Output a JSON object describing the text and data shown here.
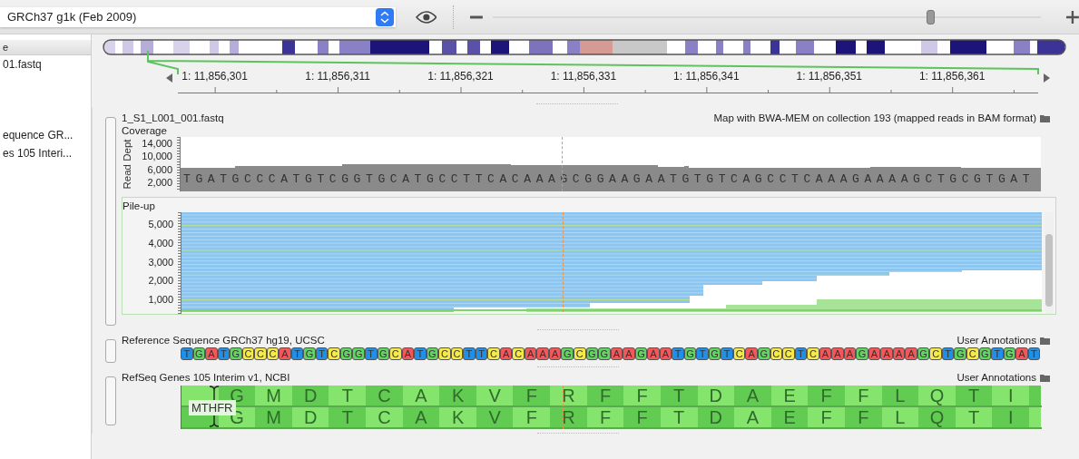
{
  "genome_selector": {
    "value": "GRCh37 g1k (Feb 2009)"
  },
  "zoom_slider": {
    "level": 0.8
  },
  "sidebar": {
    "header": "e",
    "items": [
      "01.fastq",
      "equence GR...",
      "es 105 Interi..."
    ]
  },
  "ruler": {
    "labels": [
      "1: 11,856,301",
      "1: 11,856,311",
      "1: 11,856,321",
      "1: 11,856,331",
      "1: 11,856,341",
      "1: 11,856,351",
      "1: 11,856,361"
    ]
  },
  "alignment_track": {
    "title": "1_S1_L001_001.fastq",
    "source": "Map with BWA-MEM on collection 193 (mapped reads in BAM format)",
    "coverage": {
      "label": "Coverage",
      "axis_title": "Read Dept",
      "ticks": [
        "14,000",
        "10,000",
        "6,000",
        "2,000"
      ],
      "sequence": "TGATGCCCATGTCGGTGCATGCCTTCACAAAGCGGAAGAATGTGTCAGCCTCAAAGAAAAGCTGCGTGAT"
    },
    "pileup": {
      "label": "Pile-up",
      "ticks": [
        "5,000",
        "4,000",
        "3,000",
        "2,000",
        "1,000"
      ]
    }
  },
  "reference_track": {
    "title": "Reference Sequence GRCh37 hg19, UCSC",
    "annotations": "User Annotations",
    "bases": [
      {
        "base": "T",
        "color": "#1f8fe8"
      },
      {
        "base": "G",
        "color": "#62d462"
      },
      {
        "base": "A",
        "color": "#f2585a"
      },
      {
        "base": "T",
        "color": "#1f8fe8"
      },
      {
        "base": "G",
        "color": "#62d462"
      },
      {
        "base": "C",
        "color": "#f6e94a"
      },
      {
        "base": "C",
        "color": "#f6e94a"
      },
      {
        "base": "C",
        "color": "#f6e94a"
      },
      {
        "base": "A",
        "color": "#f2585a"
      },
      {
        "base": "T",
        "color": "#1f8fe8"
      },
      {
        "base": "G",
        "color": "#62d462"
      },
      {
        "base": "T",
        "color": "#1f8fe8"
      },
      {
        "base": "C",
        "color": "#f6e94a"
      },
      {
        "base": "G",
        "color": "#62d462"
      },
      {
        "base": "G",
        "color": "#62d462"
      },
      {
        "base": "T",
        "color": "#1f8fe8"
      },
      {
        "base": "G",
        "color": "#62d462"
      },
      {
        "base": "C",
        "color": "#f6e94a"
      },
      {
        "base": "A",
        "color": "#f2585a"
      },
      {
        "base": "T",
        "color": "#1f8fe8"
      },
      {
        "base": "G",
        "color": "#62d462"
      },
      {
        "base": "C",
        "color": "#f6e94a"
      },
      {
        "base": "C",
        "color": "#f6e94a"
      },
      {
        "base": "T",
        "color": "#1f8fe8"
      },
      {
        "base": "T",
        "color": "#1f8fe8"
      },
      {
        "base": "C",
        "color": "#f6e94a"
      },
      {
        "base": "A",
        "color": "#f2585a"
      },
      {
        "base": "C",
        "color": "#f6e94a"
      },
      {
        "base": "A",
        "color": "#f2585a"
      },
      {
        "base": "A",
        "color": "#f2585a"
      },
      {
        "base": "A",
        "color": "#f2585a"
      },
      {
        "base": "G",
        "color": "#62d462"
      },
      {
        "base": "C",
        "color": "#f6e94a"
      },
      {
        "base": "G",
        "color": "#62d462"
      },
      {
        "base": "G",
        "color": "#62d462"
      },
      {
        "base": "A",
        "color": "#f2585a"
      },
      {
        "base": "A",
        "color": "#f2585a"
      },
      {
        "base": "G",
        "color": "#62d462"
      },
      {
        "base": "A",
        "color": "#f2585a"
      },
      {
        "base": "A",
        "color": "#f2585a"
      },
      {
        "base": "T",
        "color": "#1f8fe8"
      },
      {
        "base": "G",
        "color": "#62d462"
      },
      {
        "base": "T",
        "color": "#1f8fe8"
      },
      {
        "base": "G",
        "color": "#62d462"
      },
      {
        "base": "T",
        "color": "#1f8fe8"
      },
      {
        "base": "C",
        "color": "#f6e94a"
      },
      {
        "base": "A",
        "color": "#f2585a"
      },
      {
        "base": "G",
        "color": "#62d462"
      },
      {
        "base": "C",
        "color": "#f6e94a"
      },
      {
        "base": "C",
        "color": "#f6e94a"
      },
      {
        "base": "T",
        "color": "#1f8fe8"
      },
      {
        "base": "C",
        "color": "#f6e94a"
      },
      {
        "base": "A",
        "color": "#f2585a"
      },
      {
        "base": "A",
        "color": "#f2585a"
      },
      {
        "base": "A",
        "color": "#f2585a"
      },
      {
        "base": "G",
        "color": "#62d462"
      },
      {
        "base": "A",
        "color": "#f2585a"
      },
      {
        "base": "A",
        "color": "#f2585a"
      },
      {
        "base": "A",
        "color": "#f2585a"
      },
      {
        "base": "A",
        "color": "#f2585a"
      },
      {
        "base": "G",
        "color": "#62d462"
      },
      {
        "base": "C",
        "color": "#f6e94a"
      },
      {
        "base": "T",
        "color": "#1f8fe8"
      },
      {
        "base": "G",
        "color": "#62d462"
      },
      {
        "base": "C",
        "color": "#f6e94a"
      },
      {
        "base": "G",
        "color": "#62d462"
      },
      {
        "base": "T",
        "color": "#1f8fe8"
      },
      {
        "base": "G",
        "color": "#62d462"
      },
      {
        "base": "A",
        "color": "#f2585a"
      },
      {
        "base": "T",
        "color": "#1f8fe8"
      }
    ]
  },
  "gene_track": {
    "title": "RefSeq Genes 105 Interim v1, NCBI",
    "annotations": "User Annotations",
    "gene_label": "MTHFR",
    "frames": [
      [
        "G",
        "M",
        "D",
        "T",
        "C",
        "A",
        "K",
        "V",
        "F",
        "R",
        "F",
        "F",
        "T",
        "D",
        "A",
        "E",
        "F",
        "F",
        "L",
        "Q",
        "T",
        "I"
      ],
      [
        "G",
        "M",
        "D",
        "T",
        "C",
        "A",
        "K",
        "V",
        "F",
        "R",
        "F",
        "F",
        "T",
        "D",
        "A",
        "E",
        "F",
        "F",
        "L",
        "Q",
        "T",
        "I"
      ]
    ]
  }
}
